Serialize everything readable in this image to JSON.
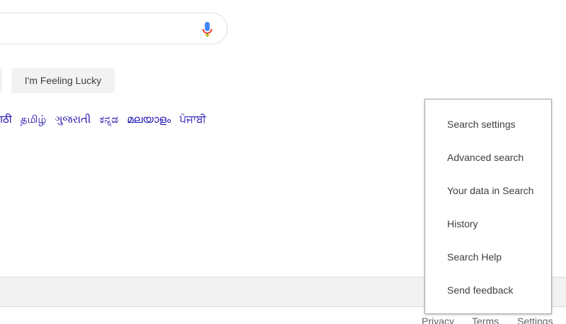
{
  "search": {
    "value": "",
    "mic_icon": "microphone-icon"
  },
  "buttons": {
    "lucky_label": "I'm Feeling Lucky"
  },
  "languages": [
    "राठी",
    "தமிழ்",
    "ગુજરાતી",
    "ಕನ್ನಡ",
    "മലയാളം",
    "ਪੰਜਾਬੀ"
  ],
  "footer": {
    "privacy": "Privacy",
    "terms": "Terms",
    "settings": "Settings"
  },
  "settings_menu": {
    "items": [
      "Search settings",
      "Advanced search",
      "Your data in Search",
      "History",
      "Search Help",
      "Send feedback"
    ]
  },
  "colors": {
    "link": "#1a0dab",
    "text": "#3c4043",
    "footer_bg": "#f2f2f2",
    "mic_blue": "#4285f4",
    "mic_red": "#ea4335",
    "mic_yellow": "#fbbc04",
    "mic_green": "#34a853"
  }
}
